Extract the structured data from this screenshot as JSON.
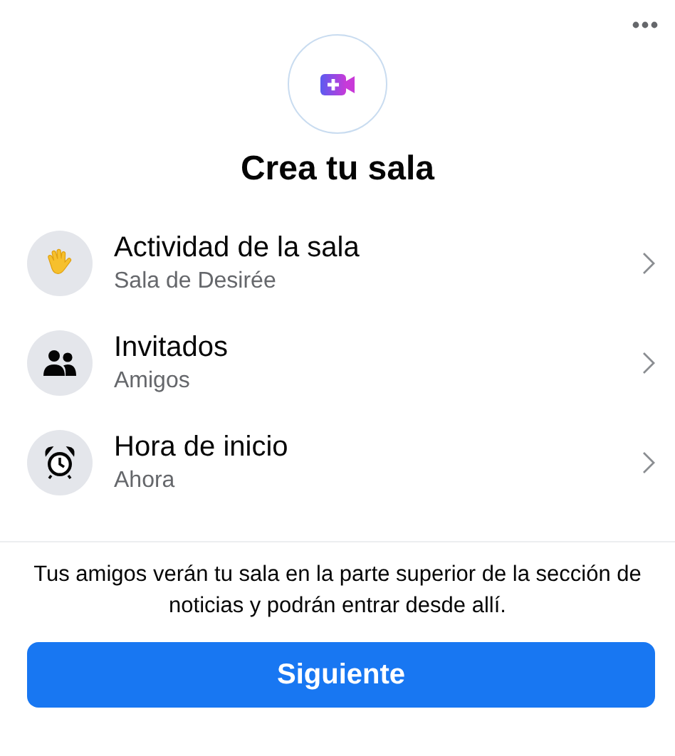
{
  "title": "Crea tu sala",
  "rows": [
    {
      "title": "Actividad de la sala",
      "subtitle": "Sala de Desirée"
    },
    {
      "title": "Invitados",
      "subtitle": "Amigos"
    },
    {
      "title": "Hora de inicio",
      "subtitle": "Ahora"
    }
  ],
  "note": "Tus amigos verán tu sala en la parte superior de la sección de noticias y podrán entrar desde allí.",
  "button": "Siguiente"
}
